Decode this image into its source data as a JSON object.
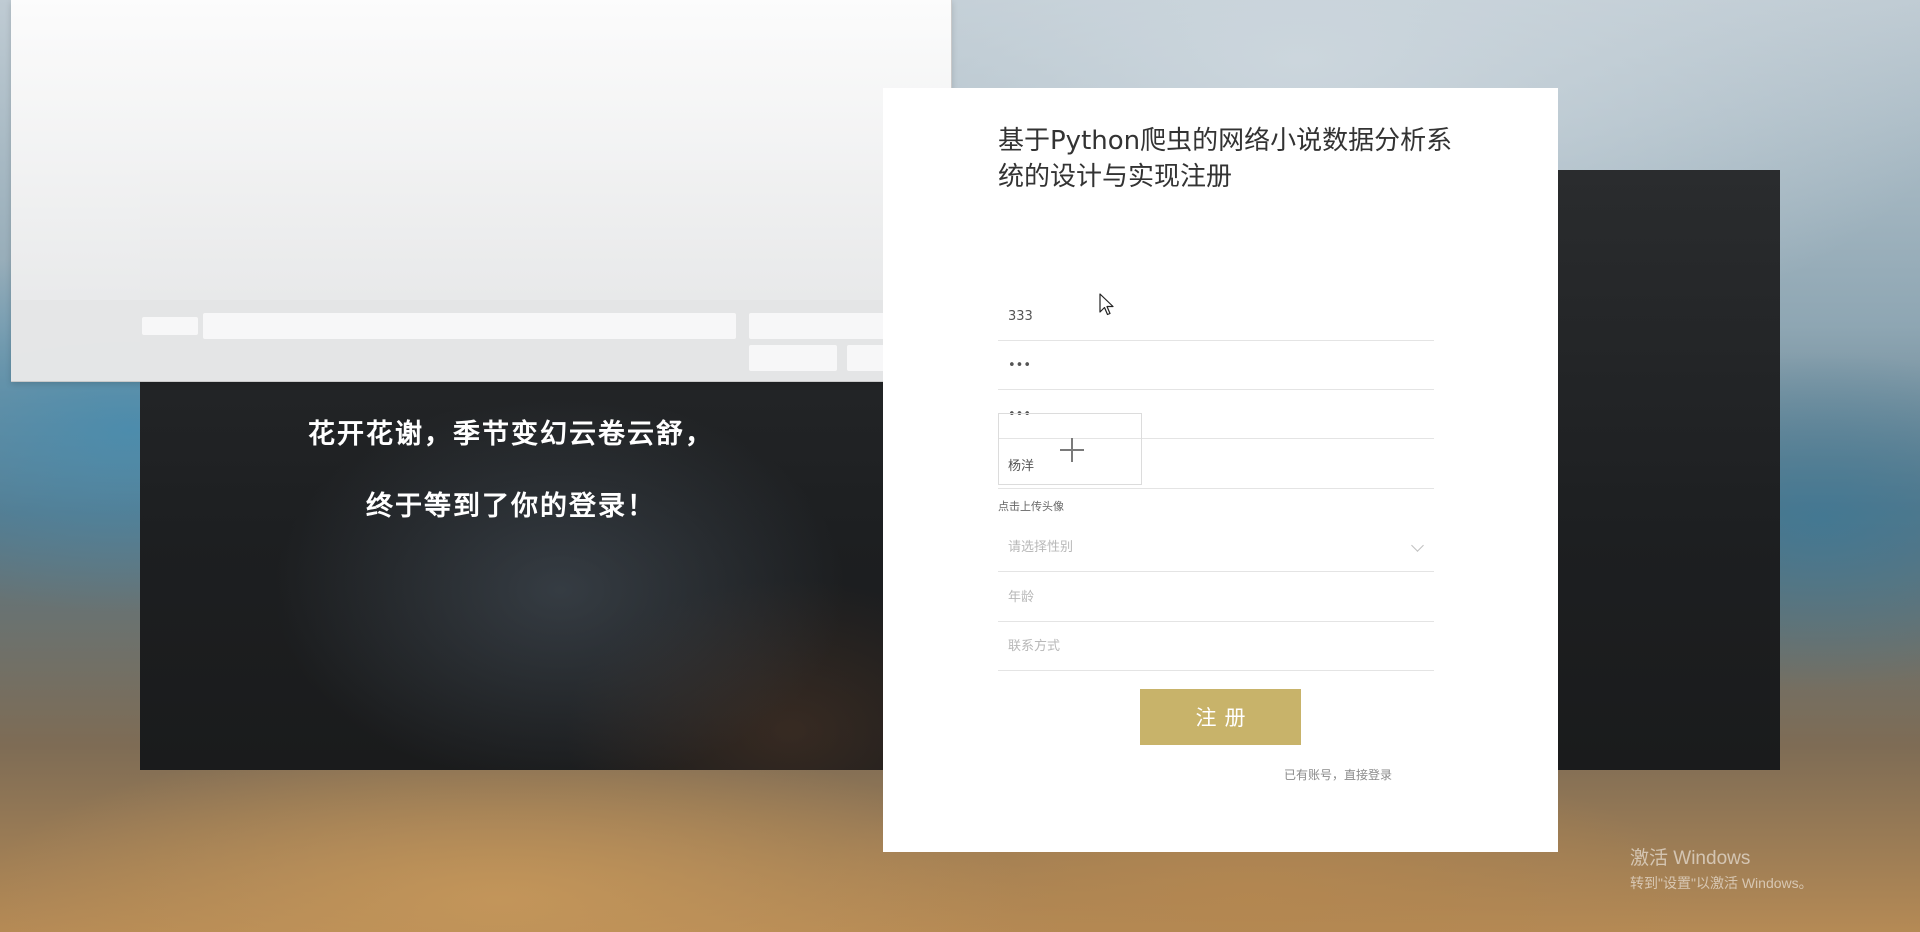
{
  "hero": {
    "line1": "花开花谢，季节变幻云卷云舒，",
    "line2": "终于等到了你的登录！"
  },
  "form": {
    "title": "基于Python爬虫的网络小说数据分析系统的设计与实现注册",
    "account_value": "333",
    "password_value": "•••",
    "confirm_password_value": "•••",
    "name_value": "杨洋",
    "avatar_upload_label": "点击上传头像",
    "gender_placeholder": "请选择性别",
    "age_placeholder": "年龄",
    "contact_placeholder": "联系方式",
    "submit_label": "注册",
    "login_link": "已有账号，直接登录"
  },
  "icons": {
    "upload": "plus-icon",
    "select": "chevron-down-icon",
    "cursor": "mouse-pointer-icon"
  },
  "colors": {
    "accent": "#c8b36a"
  },
  "watermark": {
    "line1": "激活 Windows",
    "line2": "转到\"设置\"以激活 Windows。"
  }
}
